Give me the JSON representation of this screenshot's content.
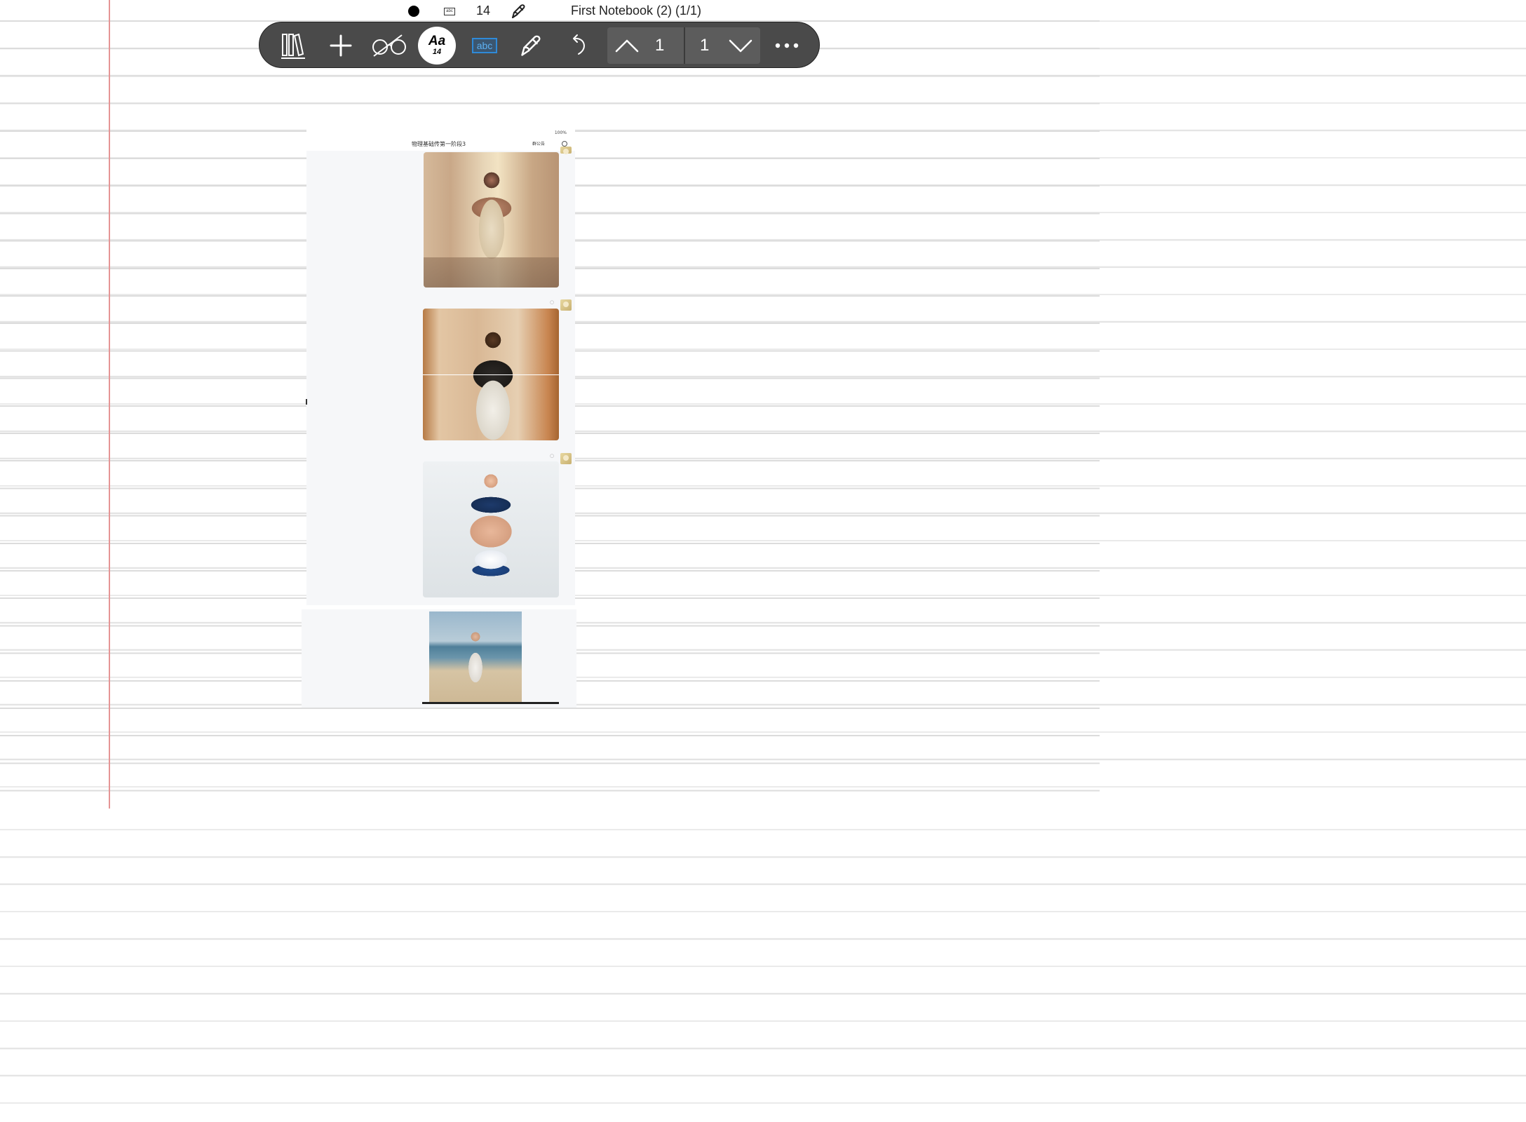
{
  "status": {
    "mini_abc": "abc",
    "font_size": "14",
    "notebook_title": "First Notebook (2) (1/1)"
  },
  "toolbar": {
    "text_style_label": "Aa",
    "text_style_size": "14",
    "textbox_label": "abc",
    "page_current": "1",
    "page_total": "1"
  },
  "pasted_screenshot": {
    "status_battery": "100%",
    "chat_title": "物理基础传第一阶段3",
    "chat_notice": "群公告"
  },
  "icons": {
    "library": "library-icon",
    "add": "plus-icon",
    "view": "glasses-icon",
    "pen": "pen-icon",
    "undo": "undo-icon",
    "page_up": "chevron-up-icon",
    "page_down": "chevron-down-icon",
    "more": "more-icon"
  },
  "colors": {
    "toolbar_bg": "#4a4a4a",
    "textbox_accent": "#2f8ad8",
    "margin_line": "#e59595"
  }
}
